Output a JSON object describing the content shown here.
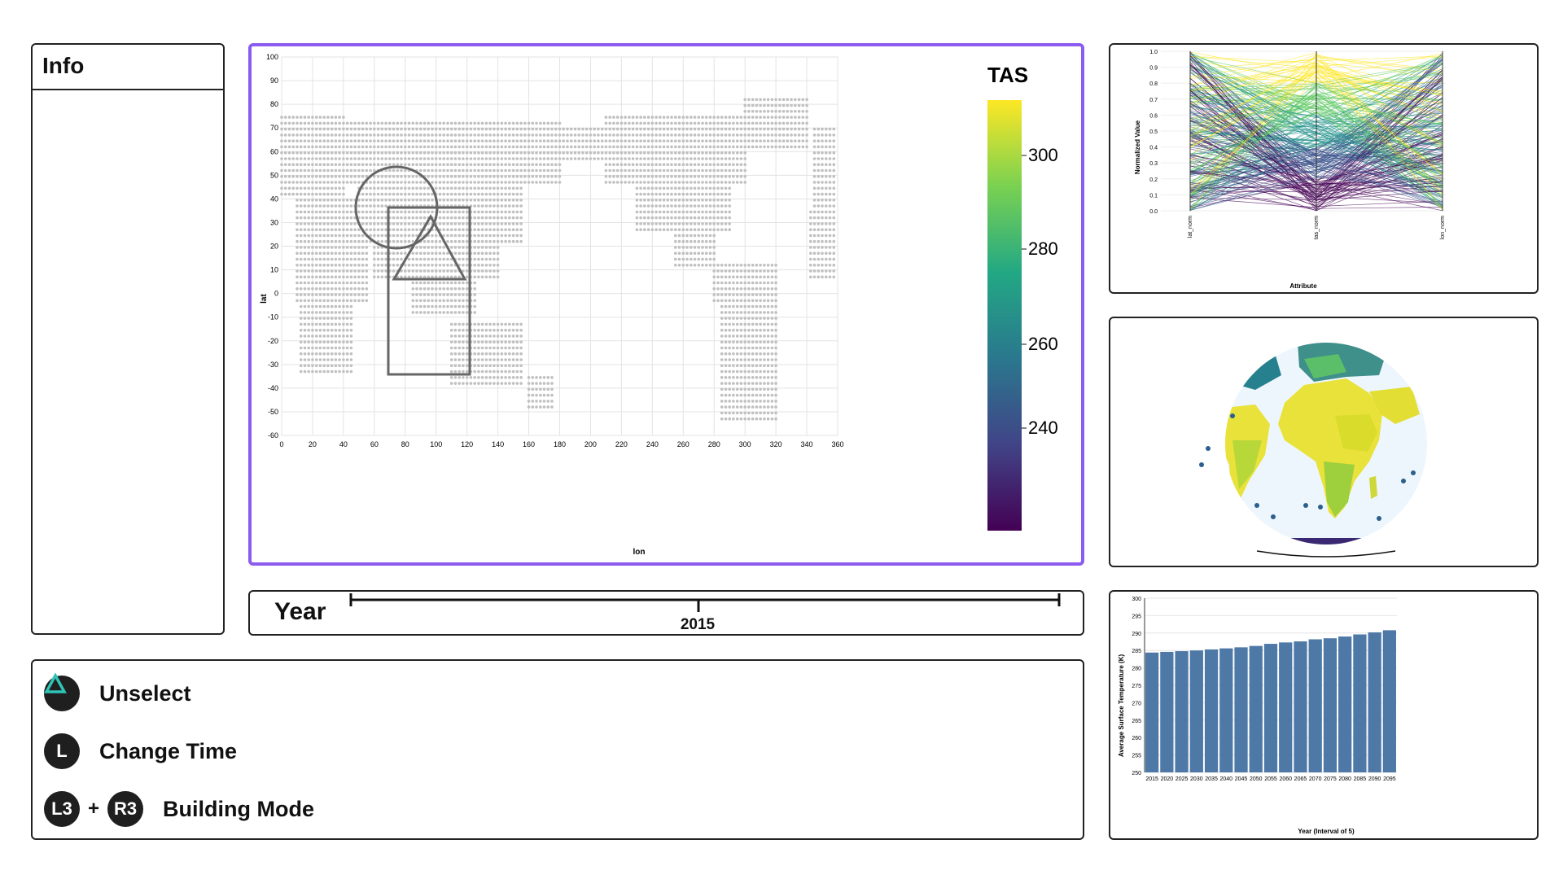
{
  "info": {
    "title": "Info"
  },
  "map": {
    "colorbar_title": "TAS",
    "colorbar_ticks": [
      "300",
      "280",
      "260",
      "240"
    ],
    "colorbar_colors": [
      "#fde725",
      "#7ad151",
      "#22a884",
      "#2a788e",
      "#414487",
      "#440154"
    ],
    "x_label": "lon",
    "y_label": "lat",
    "x_ticks": [
      "0",
      "20",
      "40",
      "60",
      "80",
      "100",
      "120",
      "140",
      "160",
      "180",
      "200",
      "220",
      "240",
      "260",
      "280",
      "300",
      "320",
      "340",
      "360"
    ],
    "y_ticks": [
      "100",
      "90",
      "80",
      "70",
      "60",
      "50",
      "40",
      "30",
      "20",
      "10",
      "0",
      "-10",
      "-20",
      "-30",
      "-40",
      "-50",
      "-60"
    ],
    "point_color": "#c0c0c0",
    "selection_shapes": [
      "circle",
      "triangle",
      "rectangle"
    ]
  },
  "year_slider": {
    "label": "Year",
    "value": "2015"
  },
  "controls": [
    {
      "button": "triangle-icon",
      "label": "Unselect"
    },
    {
      "button": "L",
      "label": "Change Time"
    },
    {
      "button": "L3",
      "button2": "R3",
      "plus": "+",
      "label": "Building Mode"
    }
  ],
  "parallel_coords": {
    "y_label": "Normalized Value",
    "x_label": "Attribute",
    "axes": [
      "lat_norm",
      "tas_norm",
      "lon_norm"
    ],
    "y_ticks": [
      "1.0",
      "0.9",
      "0.8",
      "0.7",
      "0.6",
      "0.5",
      "0.4",
      "0.3",
      "0.2",
      "0.1",
      "0.0"
    ]
  },
  "globe": {
    "ocean_color": "#eef6fd"
  },
  "chart_data": {
    "type": "bar",
    "xlabel": "Year (Interval of 5)",
    "ylabel": "Average Surface Temperature (K)",
    "ylim": [
      250,
      300
    ],
    "y_ticks": [
      "300",
      "295",
      "290",
      "285",
      "280",
      "275",
      "270",
      "265",
      "260",
      "255",
      "250"
    ],
    "categories": [
      "2015",
      "2020",
      "2025",
      "2030",
      "2035",
      "2040",
      "2045",
      "2050",
      "2055",
      "2060",
      "2065",
      "2070",
      "2075",
      "2080",
      "2085",
      "2090",
      "2095"
    ],
    "values": [
      284.4,
      284.6,
      284.8,
      285.0,
      285.3,
      285.6,
      285.9,
      286.3,
      286.9,
      287.3,
      287.6,
      288.2,
      288.5,
      289.0,
      289.6,
      290.2,
      290.8
    ],
    "bar_color": "#4e79a7"
  }
}
